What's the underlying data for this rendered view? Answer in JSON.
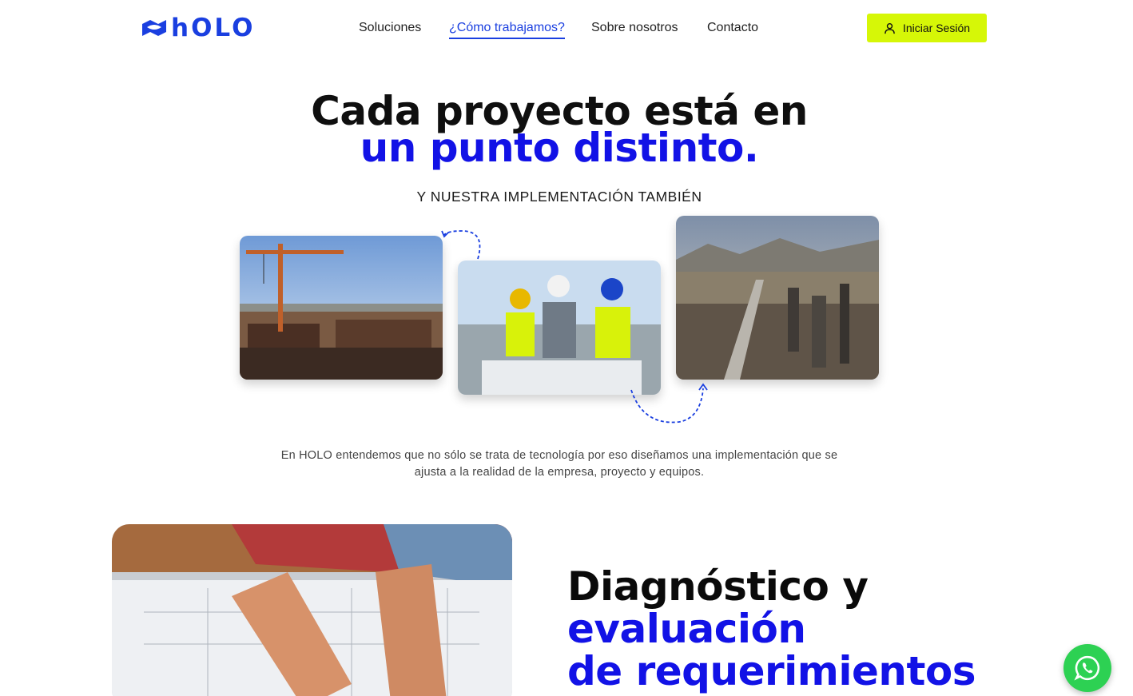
{
  "header": {
    "logo_text": "hOLO",
    "nav": [
      {
        "label": "Soluciones",
        "active": false
      },
      {
        "label": "¿Cómo trabajamos?",
        "active": true
      },
      {
        "label": "Sobre nosotros",
        "active": false
      },
      {
        "label": "Contacto",
        "active": false
      }
    ],
    "login_label": "Iniciar Sesión",
    "login_icon": "user-icon"
  },
  "hero": {
    "title_line1": "Cada proyecto está en",
    "title_line2": "un punto distinto.",
    "subtitle": "Y NUESTRA IMPLEMENTACIÓN TAMBIÉN",
    "description": "En HOLO entendemos que no sólo se trata de tecnología por eso diseñamos una implementación que se ajusta a la realidad de la empresa, proyecto y equipos."
  },
  "section": {
    "title_line1": "Diagnóstico y",
    "title_line2": "evaluación",
    "title_line3": "de requerimientos"
  },
  "whatsapp_icon": "whatsapp-icon",
  "colors": {
    "brand_blue": "#1212e6",
    "accent_lime": "#d6f707",
    "whatsapp_green": "#2dd153"
  }
}
